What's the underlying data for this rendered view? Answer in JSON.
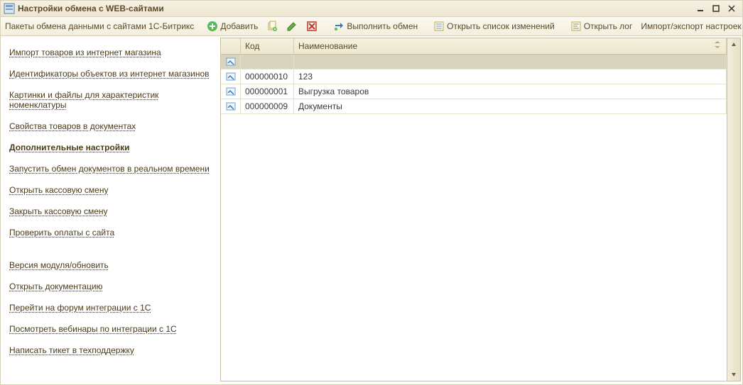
{
  "window": {
    "title": "Настройки обмена с WEB-сайтами"
  },
  "toolbar": {
    "label_packets": "Пакеты обмена данными с сайтами 1С-Битрикс",
    "add_label": "Добавить",
    "execute_label": "Выполнить обмен",
    "open_changes_label": "Открыть список изменений",
    "open_log_label": "Открыть лог",
    "import_export_label": "Импорт/экспорт настроек обмена"
  },
  "sidebar": {
    "links_group1": [
      "Импорт товаров из интернет магазина",
      "Идентификаторы объектов из интернет магазинов",
      "Картинки и файлы для характеристик номенклатуры",
      "Свойства товаров в документах",
      "Дополнительные настройки",
      "Запустить обмен документов в реальном времени",
      "Открыть кассовую смену",
      "Закрыть кассовую смену",
      "Проверить оплаты с сайта"
    ],
    "links_group2": [
      "Версия модуля/обновить",
      "Открыть документацию",
      "Перейти на форум интеграции с 1С",
      "Посмотреть вебинары по интеграции с 1С",
      "Написать тикет в техподдержку"
    ],
    "active_index": 4
  },
  "grid": {
    "columns": {
      "code": "Код",
      "name": "Наименование"
    },
    "rows": [
      {
        "code": "000000010",
        "name": "123"
      },
      {
        "code": "000000001",
        "name": "Выгрузка товаров"
      },
      {
        "code": "000000009",
        "name": "Документы"
      }
    ]
  }
}
